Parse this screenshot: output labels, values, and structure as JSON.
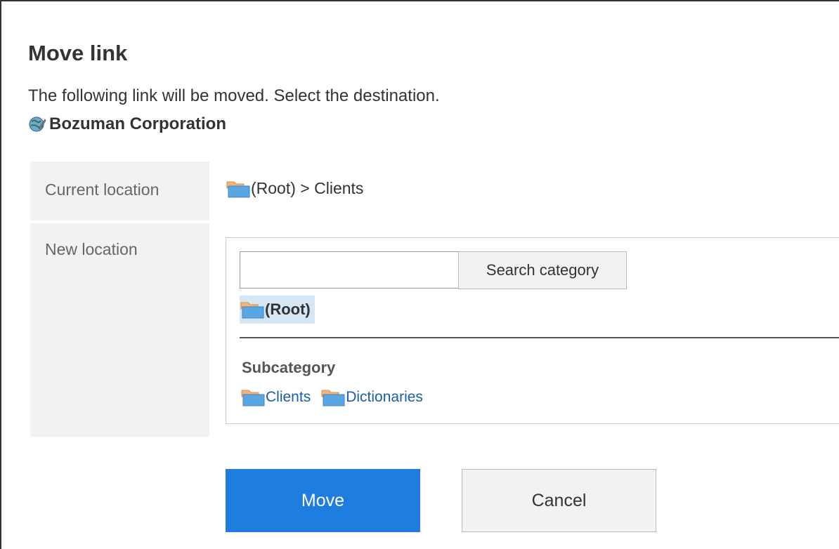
{
  "dialog": {
    "title": "Move link",
    "description": "The following link will be moved. Select the destination.",
    "link_name": "Bozuman Corporation",
    "link_icon": "globe-link-icon"
  },
  "form": {
    "current_location_label": "Current location",
    "current_location_value": "(Root) > Clients",
    "new_location_label": "New location"
  },
  "picker": {
    "search_value": "",
    "search_placeholder": "",
    "search_button_label": "Search category",
    "selected_category": "(Root)",
    "subcategory_title": "Subcategory",
    "subcategories": [
      "Clients",
      "Dictionaries"
    ]
  },
  "actions": {
    "move_label": "Move",
    "cancel_label": "Cancel"
  },
  "colors": {
    "primary_button": "#1f7de0",
    "link": "#1a5ea8",
    "selected_highlight": "#d5e6f5",
    "label_background": "#f2f2f2"
  }
}
